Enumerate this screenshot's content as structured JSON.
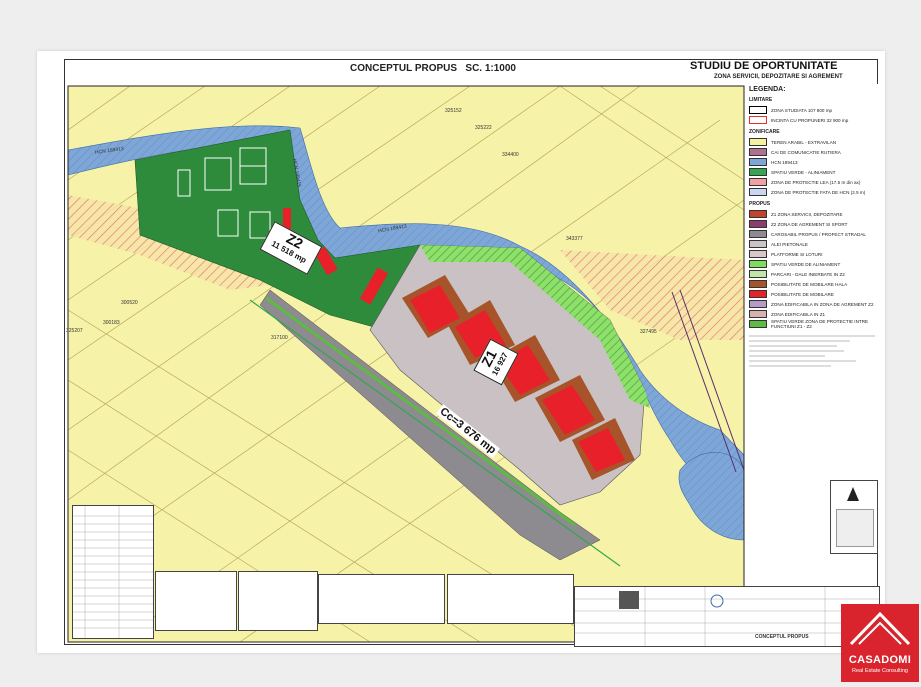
{
  "header": {
    "title": "CONCEPTUL PROPUS",
    "scale": "SC. 1:1000",
    "study": "STUDIU DE OPORTUNITATE",
    "subtitle": "ZONA SERVICII, DEPOZITARE SI AGREMENT"
  },
  "map": {
    "parcels": [
      "325152",
      "325222",
      "334400",
      "343377",
      "300520",
      "300183",
      "325207",
      "327495",
      "317100"
    ],
    "canal_labels": [
      "HCN 189413",
      "HCN 189415",
      "HCN 189413"
    ],
    "zone2": {
      "name": "Z2",
      "area": "11 518 mp"
    },
    "zone1": {
      "name": "Z1",
      "area": "16 927"
    },
    "road_label": "Cc=3 676 mp"
  },
  "legend": {
    "title": "LEGENDA:",
    "limits_heading": "LIMITARE",
    "limits": [
      {
        "label": "ZONA STUDIATA 107 800 mp",
        "color": "#ffffff",
        "border": "#000000"
      },
      {
        "label": "INCINTA CU PROPUNERI 32 900 mp",
        "color": "#ffffff",
        "border": "#e03030"
      }
    ],
    "zoning_heading": "ZONIFICARE",
    "zoning": [
      {
        "label": "TEREN ARABIL - EXTRAVILAN",
        "color": "#f5f3a0"
      },
      {
        "label": "CAI DE COMUNICATIE RUTIERA",
        "color": "#b07090"
      },
      {
        "label": "HCN 189413",
        "color": "#7ea7d8"
      },
      {
        "label": "SPATIU VERDE - ALINIAMENT",
        "color": "#2fa84f"
      },
      {
        "label": "ZONA DE PROTECTIE LEA (17.5 m din ax)",
        "color": "#f3a0a0"
      },
      {
        "label": "ZONA DE PROTECTIE FATA DE HCN (2.5 m)",
        "color": "#c9d6f2"
      }
    ],
    "proposed_heading": "PROPUS",
    "proposed": [
      {
        "label": "Z1 ZONA SERVICII, DEPOZITARE",
        "color": "#c0442c"
      },
      {
        "label": "Z2 ZONA DE AGREMENT SI SPORT",
        "color": "#8a3d6e"
      },
      {
        "label": "CAROSABIL PROPUS / PROFECT STRADAL",
        "color": "#8d8a90"
      },
      {
        "label": "ALEI PIETONALE",
        "color": "#c8c4c4"
      },
      {
        "label": "PLATFORME SI LOTURI",
        "color": "#d9c7c7"
      },
      {
        "label": "SPATIU VERDE DE ALINIAMENT",
        "color": "#7ddc5a"
      },
      {
        "label": "PARCARI - DALE INIERBATE IN Z2",
        "color": "#bfe6a6"
      },
      {
        "label": "POSIBILITATE DE MOBILARE HALA",
        "color": "#a8542a"
      },
      {
        "label": "POSIBILITATE DE MOBILARE",
        "color": "#e8202a"
      },
      {
        "label": "ZONA EDIFICABILA IN ZONA DE AGREMENT Z2",
        "color": "#b59bc8"
      },
      {
        "label": "ZONA EDIFICABILA IN Z1",
        "color": "#d8b0b0"
      },
      {
        "label": "SPATIU VERDE ZONA DE PROTECTIE INTRE FUNCTIUNI Z1 - Z2",
        "color": "#5dbb43"
      }
    ]
  },
  "logo": {
    "name": "CASADOMI",
    "tagline": "Real Estate Consulting",
    "color": "#d9232d"
  }
}
